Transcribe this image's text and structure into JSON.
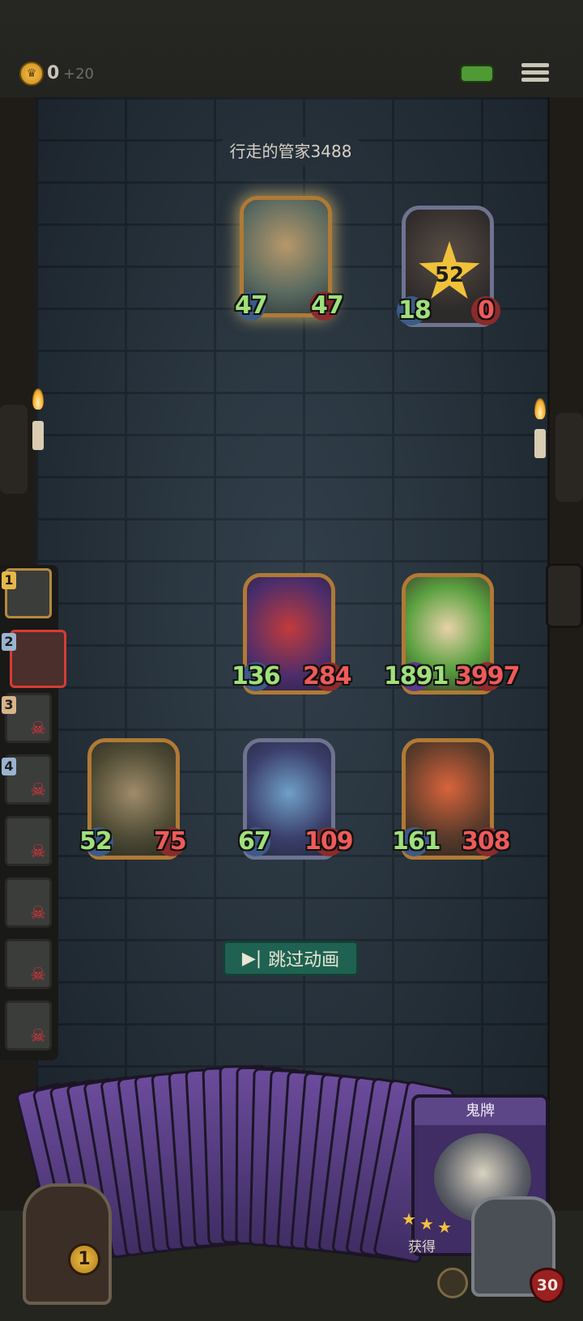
{
  "top_bar": {
    "coin_value": "0",
    "coin_bonus": "+20"
  },
  "enemy": {
    "name_plate": "行走的管家3488"
  },
  "board": {
    "enemy_cards": [
      {
        "atk": "47",
        "hp": "47"
      },
      {
        "atk": "18",
        "hp": "0",
        "damage": "52"
      }
    ],
    "ally_cards": [
      {
        "atk": "136",
        "hp": "284"
      },
      {
        "atk": "1891",
        "hp": "3997"
      },
      {
        "atk": "52",
        "hp": "75"
      },
      {
        "atk": "67",
        "hp": "109"
      },
      {
        "atk": "161",
        "hp": "308"
      }
    ]
  },
  "queue": {
    "labels": [
      "1",
      "2",
      "3",
      "4"
    ]
  },
  "skip_button": {
    "label": "跳过动画"
  },
  "hand": {
    "featured_card_title": "鬼牌",
    "featured_card_text": "获得"
  },
  "deck": {
    "count": "1"
  },
  "hero": {
    "hp": "30"
  },
  "colors": {
    "attack": "#9fe07b",
    "health": "#ef5a5a",
    "wall": "#2d3a45",
    "skip_button": "#1f6251"
  }
}
